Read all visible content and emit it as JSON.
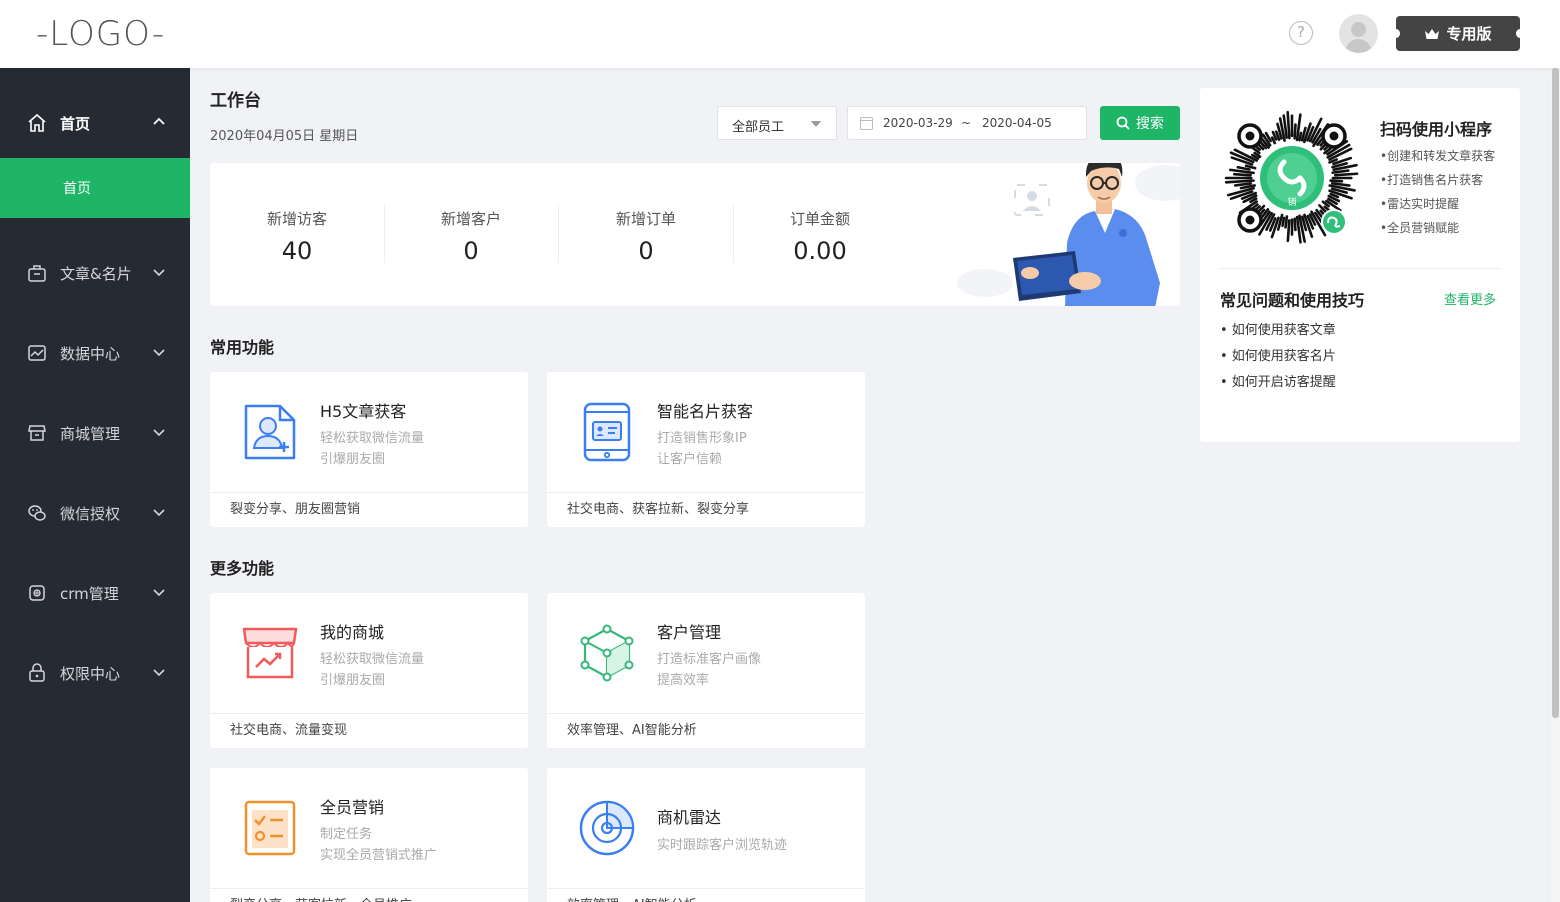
{
  "header": {
    "logo": "-LOGO-",
    "help": "?",
    "pro_label": "专用版"
  },
  "sidebar": {
    "items": [
      {
        "label": "首页",
        "icon": "home-icon",
        "expanded": true
      },
      {
        "label": "文章&名片",
        "icon": "briefcase-icon"
      },
      {
        "label": "数据中心",
        "icon": "chart-icon"
      },
      {
        "label": "商城管理",
        "icon": "store-icon"
      },
      {
        "label": "微信授权",
        "icon": "wechat-icon"
      },
      {
        "label": "crm管理",
        "icon": "crm-icon"
      },
      {
        "label": "权限中心",
        "icon": "lock-icon"
      }
    ],
    "active_sub": "首页"
  },
  "main": {
    "title": "工作台",
    "date": "2020年04月05日 星期日",
    "filter": {
      "staff_select": "全部员工",
      "date_start": "2020-03-29",
      "date_sep": "~",
      "date_end": "2020-04-05",
      "search_label": "搜索"
    },
    "stats": [
      {
        "label": "新增访客",
        "value": "40"
      },
      {
        "label": "新增客户",
        "value": "0"
      },
      {
        "label": "新增订单",
        "value": "0"
      },
      {
        "label": "订单金额",
        "value": "0.00"
      }
    ],
    "common_title": "常用功能",
    "more_title": "更多功能",
    "common": [
      {
        "title": "H5文章获客",
        "desc1": "轻松获取微信流量",
        "desc2": "引爆朋友圈",
        "tags": "裂变分享、朋友圈营销",
        "icon": "article-user-icon"
      },
      {
        "title": "智能名片获客",
        "desc1": "打造销售形象IP",
        "desc2": "让客户信赖",
        "tags": "社交电商、获客拉新、裂变分享",
        "icon": "phone-card-icon"
      }
    ],
    "more": [
      {
        "title": "我的商城",
        "desc1": "轻松获取微信流量",
        "desc2": "引爆朋友圈",
        "tags": "社交电商、流量变现",
        "icon": "store-trend-icon"
      },
      {
        "title": "客户管理",
        "desc1": "打造标准客户画像",
        "desc2": "提高效率",
        "tags": "效率管理、AI智能分析",
        "icon": "cube-network-icon"
      },
      {
        "title": "全员营销",
        "desc1": "制定任务",
        "desc2": "实现全员营销式推广",
        "tags": "裂变分享、获客拉新、全员推广",
        "icon": "task-list-icon"
      },
      {
        "title": "商机雷达",
        "desc1": "实时跟踪客户浏览轨迹",
        "desc2": "",
        "tags": "效率管理、AI智能分析",
        "icon": "radar-icon"
      }
    ]
  },
  "right": {
    "title": "扫码使用小程序",
    "features": [
      "•创建和转发文章获客",
      "•打造销售名片获客",
      "•雷达实时提醒",
      "•全员营销赋能"
    ],
    "qr_center_text": "销",
    "faq_title": "常见问题和使用技巧",
    "faq_more": "查看更多",
    "faq": [
      "• 如何使用获客文章",
      "• 如何使用获客名片",
      "• 如何开启访客提醒"
    ]
  },
  "colors": {
    "accent": "#1fb567",
    "sidebar_bg": "#262b33",
    "page_bg": "#f0f2f5"
  }
}
